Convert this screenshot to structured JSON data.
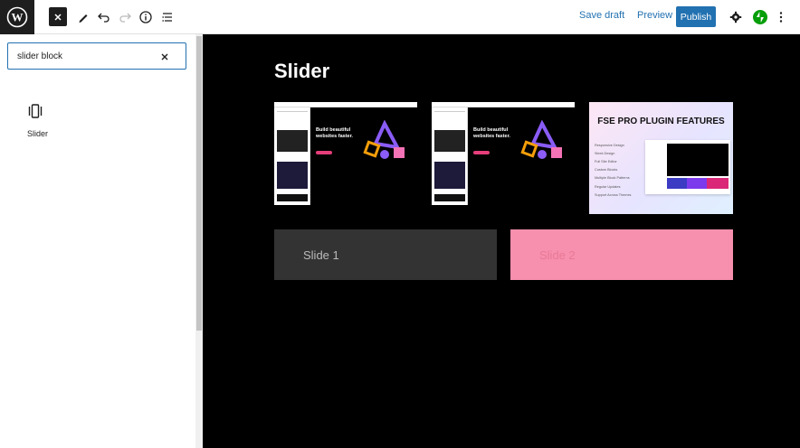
{
  "toolbar": {
    "save_draft_label": "Save draft",
    "preview_label": "Preview",
    "publish_label": "Publish"
  },
  "inserter": {
    "search_value": "slider block",
    "results": [
      {
        "label": "Slider",
        "icon": "slider-icon"
      }
    ]
  },
  "canvas": {
    "title": "Slider",
    "gallery": [
      {
        "alt": "editor screenshot 1",
        "hero_text": "Build beautiful websites faster."
      },
      {
        "alt": "editor screenshot 2",
        "hero_text": "Build beautiful websites faster."
      },
      {
        "alt": "fse pro plugin features",
        "heading": "FSE PRO PLUGIN FEATURES",
        "features": [
          "Responsive Design",
          "Sleek Design",
          "Full Site Editor",
          "Custom Blocks",
          "Multiple Block Patterns",
          "Regular Updates",
          "Support Across Themes"
        ]
      }
    ],
    "slides": [
      {
        "label": "Slide 1"
      },
      {
        "label": "Slide 2"
      }
    ]
  },
  "colors": {
    "accent": "#2271b1",
    "canvas_bg": "#000000",
    "slide1_bg": "#333333",
    "slide2_bg": "#f78fae",
    "jetpack": "#069e08"
  }
}
